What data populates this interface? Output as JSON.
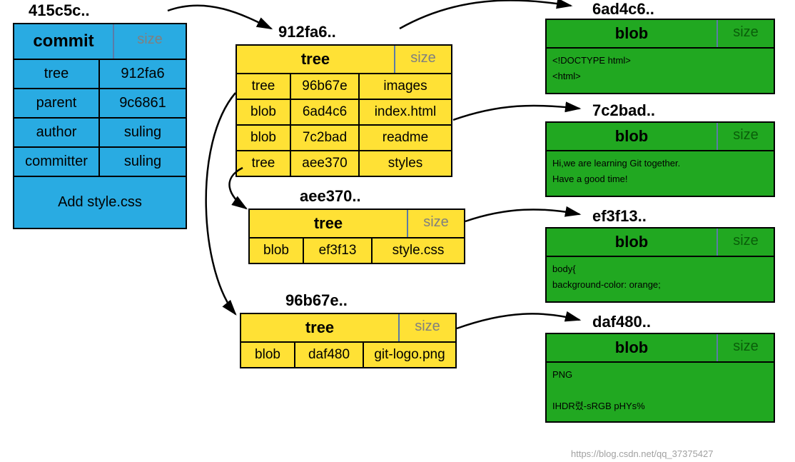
{
  "commit": {
    "hash": "415c5c..",
    "type": "commit",
    "size_label": "size",
    "rows": [
      {
        "k": "tree",
        "v": "912fa6"
      },
      {
        "k": "parent",
        "v": "9c6861"
      },
      {
        "k": "author",
        "v": "suling"
      },
      {
        "k": "committer",
        "v": "suling"
      }
    ],
    "message": "Add style.css"
  },
  "trees": [
    {
      "hash": "912fa6..",
      "type": "tree",
      "size_label": "size",
      "rows": [
        {
          "t": "tree",
          "h": "96b67e",
          "n": "images"
        },
        {
          "t": "blob",
          "h": "6ad4c6",
          "n": "index.html"
        },
        {
          "t": "blob",
          "h": "7c2bad",
          "n": "readme"
        },
        {
          "t": "tree",
          "h": "aee370",
          "n": "styles"
        }
      ]
    },
    {
      "hash": "aee370..",
      "type": "tree",
      "size_label": "size",
      "rows": [
        {
          "t": "blob",
          "h": "ef3f13",
          "n": "style.css"
        }
      ]
    },
    {
      "hash": "96b67e..",
      "type": "tree",
      "size_label": "size",
      "rows": [
        {
          "t": "blob",
          "h": "daf480",
          "n": "git-logo.png"
        }
      ]
    }
  ],
  "blobs": [
    {
      "hash": "6ad4c6..",
      "type": "blob",
      "size_label": "size",
      "body": "<!DOCTYPE html>\n<html>"
    },
    {
      "hash": "7c2bad..",
      "type": "blob",
      "size_label": "size",
      "body": "Hi,we are learning Git together.\nHave a good time!"
    },
    {
      "hash": "ef3f13..",
      "type": "blob",
      "size_label": "size",
      "body": "body{\n  background-color: orange;"
    },
    {
      "hash": "daf480..",
      "type": "blob",
      "size_label": "size",
      "body": "PNG\n\nIHDR렸-sRGB pHYs%"
    }
  ],
  "watermark": "https://blog.csdn.net/qq_37375427"
}
